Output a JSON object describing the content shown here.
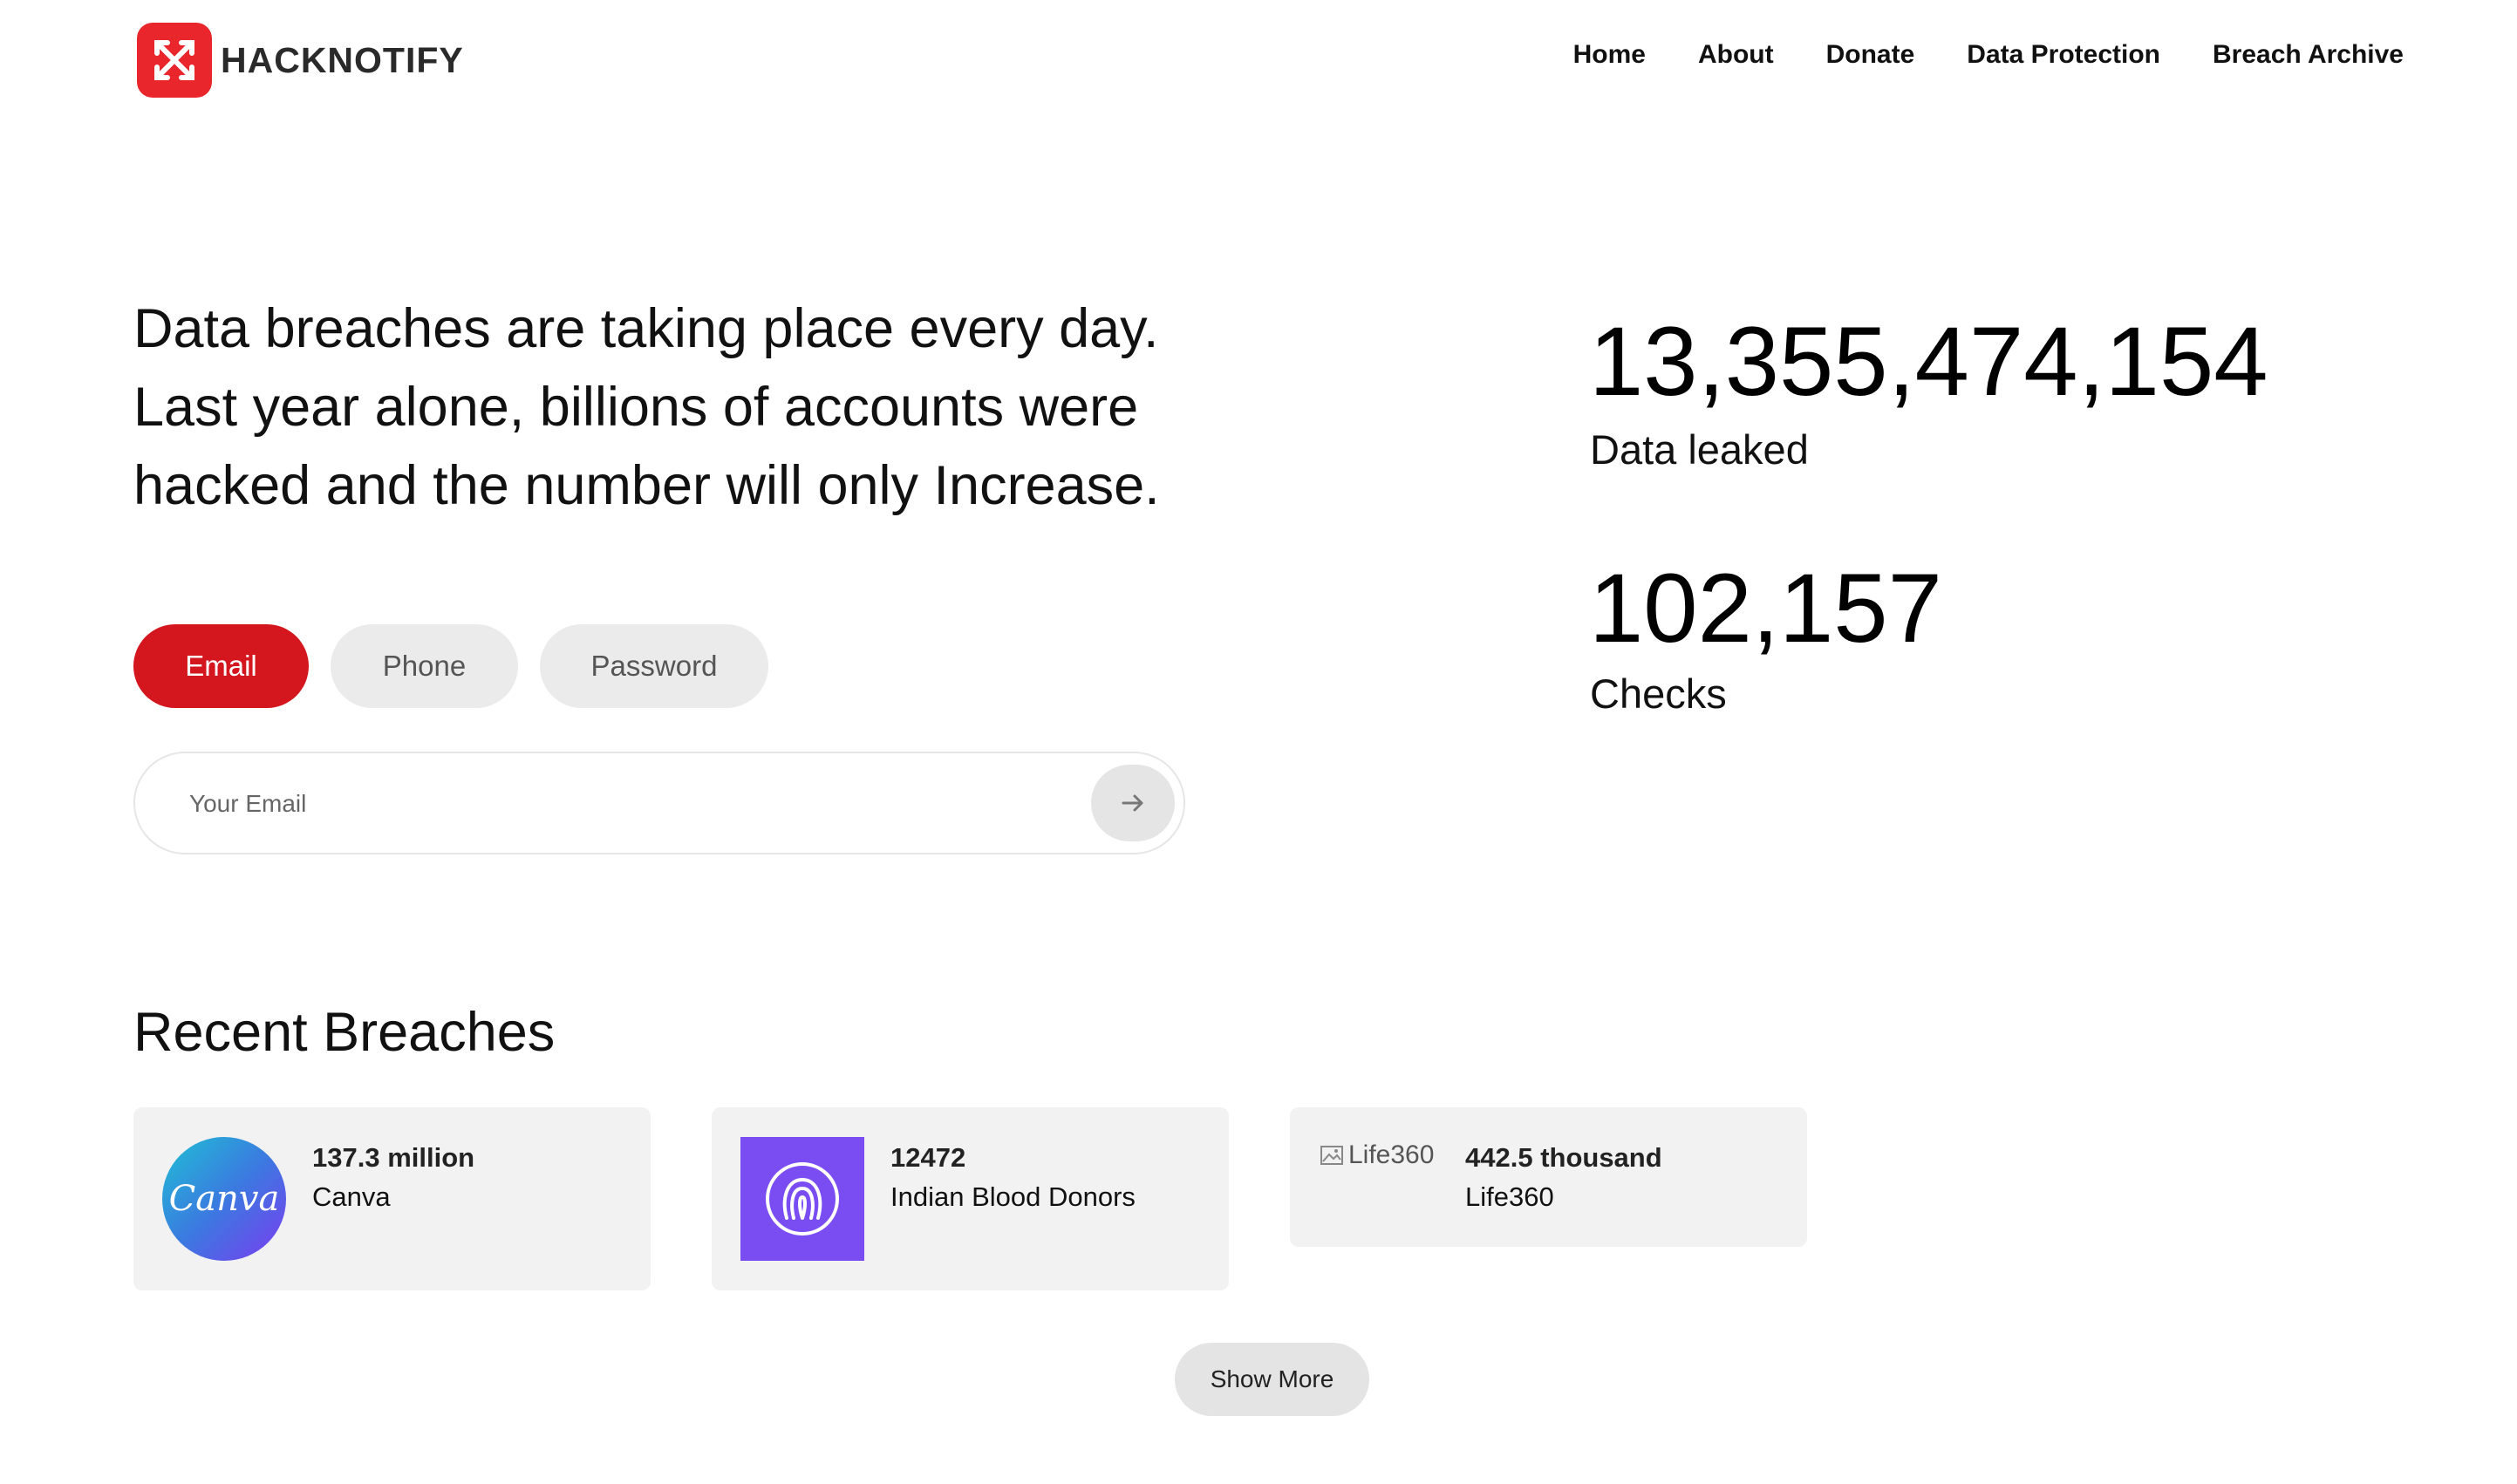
{
  "brand": {
    "name": "HACKNOTIFY",
    "accent_color": "#e8262c",
    "logo_icon": "crossed-arrows-icon"
  },
  "nav": {
    "items": [
      {
        "label": "Home"
      },
      {
        "label": "About"
      },
      {
        "label": "Donate"
      },
      {
        "label": "Data Protection"
      },
      {
        "label": "Breach Archive"
      }
    ]
  },
  "hero": {
    "lines": [
      "Data breaches are taking place every day.",
      "Last year alone, billions of accounts were",
      "hacked and the number will only Increase."
    ]
  },
  "search": {
    "tabs": [
      {
        "label": "Email",
        "active": true
      },
      {
        "label": "Phone",
        "active": false
      },
      {
        "label": "Password",
        "active": false
      }
    ],
    "placeholder": "Your Email",
    "value": "",
    "submit_icon": "arrow-right-icon"
  },
  "stats": [
    {
      "value": "13,355,474,154",
      "label": "Data leaked"
    },
    {
      "value": "102,157",
      "label": "Checks"
    }
  ],
  "recent": {
    "title": "Recent Breaches",
    "cards": [
      {
        "count": "137.3 million",
        "name": "Canva",
        "logo_text": "Canva",
        "logo_icon": "canva-logo"
      },
      {
        "count": "12472",
        "name": "Indian Blood Donors",
        "logo_icon": "fingerprint-loop-icon"
      },
      {
        "count": "442.5 thousand",
        "name": "Life360",
        "image_alt": "Life360",
        "logo_icon": "broken-image-icon"
      }
    ],
    "show_more_label": "Show More"
  }
}
